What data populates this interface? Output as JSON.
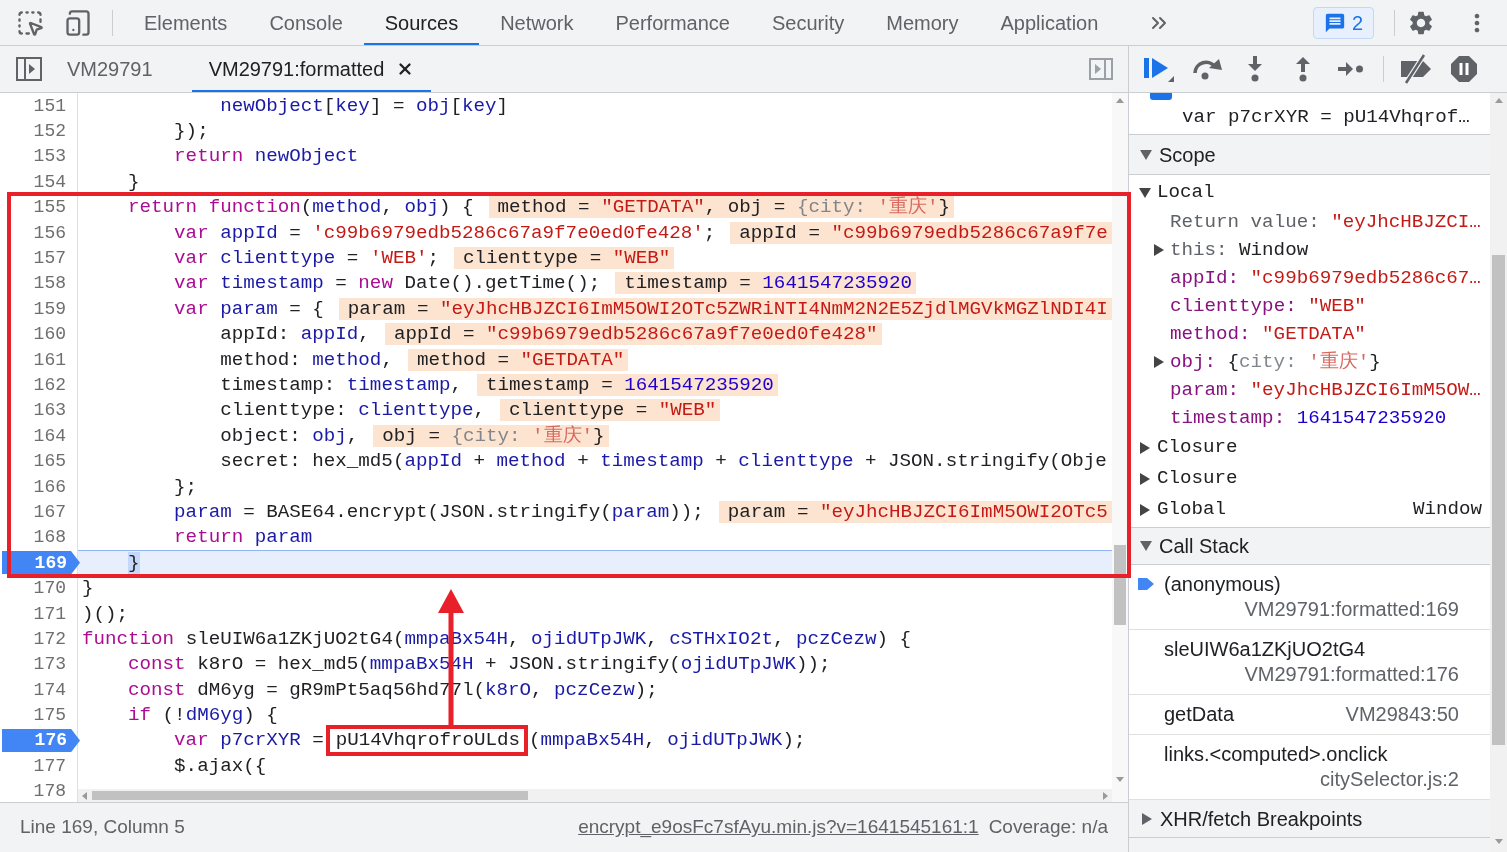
{
  "toolbar": {
    "tabs": [
      {
        "label": "Elements",
        "selected": false
      },
      {
        "label": "Console",
        "selected": false
      },
      {
        "label": "Sources",
        "selected": true
      },
      {
        "label": "Network",
        "selected": false
      },
      {
        "label": "Performance",
        "selected": false
      },
      {
        "label": "Security",
        "selected": false
      },
      {
        "label": "Memory",
        "selected": false
      },
      {
        "label": "Application",
        "selected": false
      }
    ],
    "issues": {
      "count": "2"
    }
  },
  "file_tabs": [
    {
      "label": "VM29791",
      "selected": false,
      "closable": false
    },
    {
      "label": "VM29791:formatted",
      "selected": true,
      "closable": true
    }
  ],
  "editor": {
    "lines": [
      {
        "number": "151",
        "tokens": [
          {
            "text": "            newObject",
            "kind": "variable"
          },
          {
            "text": "[",
            "kind": "plain"
          },
          {
            "text": "key",
            "kind": "variable"
          },
          {
            "text": "] = ",
            "kind": "plain"
          },
          {
            "text": "obj",
            "kind": "variable"
          },
          {
            "text": "[",
            "kind": "plain"
          },
          {
            "text": "key",
            "kind": "variable"
          },
          {
            "text": "]",
            "kind": "plain"
          }
        ],
        "breakpoint": false,
        "current": false
      },
      {
        "number": "152",
        "tokens": [
          {
            "text": "        });",
            "kind": "plain"
          }
        ],
        "breakpoint": false,
        "current": false
      },
      {
        "number": "153",
        "tokens": [
          {
            "text": "        return ",
            "kind": "keyword"
          },
          {
            "text": "newObject",
            "kind": "variable"
          }
        ],
        "breakpoint": false,
        "current": false
      },
      {
        "number": "154",
        "tokens": [
          {
            "text": "    }",
            "kind": "plain"
          }
        ],
        "breakpoint": false,
        "current": false
      },
      {
        "number": "155",
        "tokens": [
          {
            "text": "    return function",
            "kind": "keyword"
          },
          {
            "text": "(",
            "kind": "plain"
          },
          {
            "text": "method",
            "kind": "variable"
          },
          {
            "text": ", ",
            "kind": "plain"
          },
          {
            "text": "obj",
            "kind": "variable"
          },
          {
            "text": ") {",
            "kind": "plain"
          }
        ],
        "inline": [
          {
            "text": "method = ",
            "kind": "plain"
          },
          {
            "text": "\"GETDATA\"",
            "kind": "string"
          },
          {
            "text": ", obj = ",
            "kind": "plain"
          },
          {
            "text": "{city: ",
            "kind": "dim"
          },
          {
            "text": "'重庆'",
            "kind": "cjk"
          },
          {
            "text": "}",
            "kind": "plain"
          }
        ],
        "breakpoint": false,
        "current": false
      },
      {
        "number": "156",
        "tokens": [
          {
            "text": "        var ",
            "kind": "keyword"
          },
          {
            "text": "appId",
            "kind": "variable"
          },
          {
            "text": " = ",
            "kind": "plain"
          },
          {
            "text": "'c99b6979edb5286c67a9f7e0ed0fe428'",
            "kind": "string"
          },
          {
            "text": ";",
            "kind": "plain"
          }
        ],
        "inline": [
          {
            "text": "appId = ",
            "kind": "plain"
          },
          {
            "text": "\"c99b6979edb5286c67a9f7e",
            "kind": "string"
          }
        ],
        "breakpoint": false,
        "current": false
      },
      {
        "number": "157",
        "tokens": [
          {
            "text": "        var ",
            "kind": "keyword"
          },
          {
            "text": "clienttype",
            "kind": "variable"
          },
          {
            "text": " = ",
            "kind": "plain"
          },
          {
            "text": "'WEB'",
            "kind": "string"
          },
          {
            "text": ";",
            "kind": "plain"
          }
        ],
        "inline": [
          {
            "text": "clienttype = ",
            "kind": "plain"
          },
          {
            "text": "\"WEB\"",
            "kind": "string"
          }
        ],
        "breakpoint": false,
        "current": false
      },
      {
        "number": "158",
        "tokens": [
          {
            "text": "        var ",
            "kind": "keyword"
          },
          {
            "text": "timestamp",
            "kind": "variable"
          },
          {
            "text": " = ",
            "kind": "plain"
          },
          {
            "text": "new",
            "kind": "keyword"
          },
          {
            "text": " Date().getTime();",
            "kind": "plain"
          }
        ],
        "inline": [
          {
            "text": "timestamp = ",
            "kind": "plain"
          },
          {
            "text": "1641547235920",
            "kind": "number"
          }
        ],
        "breakpoint": false,
        "current": false
      },
      {
        "number": "159",
        "tokens": [
          {
            "text": "        var ",
            "kind": "keyword"
          },
          {
            "text": "param",
            "kind": "variable"
          },
          {
            "text": " = {",
            "kind": "plain"
          }
        ],
        "inline": [
          {
            "text": "param = ",
            "kind": "plain"
          },
          {
            "text": "\"eyJhcHBJZCI6ImM5OWI2OTc5ZWRiNTI4NmM2N2E5ZjdlMGVkMGZlNDI4I",
            "kind": "string"
          }
        ],
        "breakpoint": false,
        "current": false
      },
      {
        "number": "160",
        "tokens": [
          {
            "text": "            appId: ",
            "kind": "plain"
          },
          {
            "text": "appId",
            "kind": "variable"
          },
          {
            "text": ",",
            "kind": "plain"
          }
        ],
        "inline": [
          {
            "text": "appId = ",
            "kind": "plain"
          },
          {
            "text": "\"c99b6979edb5286c67a9f7e0ed0fe428\"",
            "kind": "string"
          }
        ],
        "breakpoint": false,
        "current": false
      },
      {
        "number": "161",
        "tokens": [
          {
            "text": "            method: ",
            "kind": "plain"
          },
          {
            "text": "method",
            "kind": "variable"
          },
          {
            "text": ",",
            "kind": "plain"
          }
        ],
        "inline": [
          {
            "text": "method = ",
            "kind": "plain"
          },
          {
            "text": "\"GETDATA\"",
            "kind": "string"
          }
        ],
        "breakpoint": false,
        "current": false
      },
      {
        "number": "162",
        "tokens": [
          {
            "text": "            timestamp: ",
            "kind": "plain"
          },
          {
            "text": "timestamp",
            "kind": "variable"
          },
          {
            "text": ",",
            "kind": "plain"
          }
        ],
        "inline": [
          {
            "text": "timestamp = ",
            "kind": "plain"
          },
          {
            "text": "1641547235920",
            "kind": "number"
          }
        ],
        "breakpoint": false,
        "current": false
      },
      {
        "number": "163",
        "tokens": [
          {
            "text": "            clienttype: ",
            "kind": "plain"
          },
          {
            "text": "clienttype",
            "kind": "variable"
          },
          {
            "text": ",",
            "kind": "plain"
          }
        ],
        "inline": [
          {
            "text": "clienttype = ",
            "kind": "plain"
          },
          {
            "text": "\"WEB\"",
            "kind": "string"
          }
        ],
        "breakpoint": false,
        "current": false
      },
      {
        "number": "164",
        "tokens": [
          {
            "text": "            object: ",
            "kind": "plain"
          },
          {
            "text": "obj",
            "kind": "variable"
          },
          {
            "text": ",",
            "kind": "plain"
          }
        ],
        "inline": [
          {
            "text": "obj = ",
            "kind": "plain"
          },
          {
            "text": "{city: ",
            "kind": "dim"
          },
          {
            "text": "'重庆'",
            "kind": "cjk"
          },
          {
            "text": "}",
            "kind": "plain"
          }
        ],
        "breakpoint": false,
        "current": false
      },
      {
        "number": "165",
        "tokens": [
          {
            "text": "            secret: hex_md5(",
            "kind": "plain"
          },
          {
            "text": "appId",
            "kind": "variable"
          },
          {
            "text": " + ",
            "kind": "plain"
          },
          {
            "text": "method",
            "kind": "variable"
          },
          {
            "text": " + ",
            "kind": "plain"
          },
          {
            "text": "timestamp",
            "kind": "variable"
          },
          {
            "text": " + ",
            "kind": "plain"
          },
          {
            "text": "clienttype",
            "kind": "variable"
          },
          {
            "text": " + JSON.stringify(Obje",
            "kind": "plain"
          }
        ],
        "breakpoint": false,
        "current": false
      },
      {
        "number": "166",
        "tokens": [
          {
            "text": "        };",
            "kind": "plain"
          }
        ],
        "breakpoint": false,
        "current": false
      },
      {
        "number": "167",
        "tokens": [
          {
            "text": "        param",
            "kind": "variable"
          },
          {
            "text": " = BASE64.encrypt(JSON.stringify(",
            "kind": "plain"
          },
          {
            "text": "param",
            "kind": "variable"
          },
          {
            "text": "));",
            "kind": "plain"
          }
        ],
        "inline": [
          {
            "text": "param = ",
            "kind": "plain"
          },
          {
            "text": "\"eyJhcHBJZCI6ImM5OWI2OTc5",
            "kind": "string"
          }
        ],
        "breakpoint": false,
        "current": false
      },
      {
        "number": "168",
        "tokens": [
          {
            "text": "        return ",
            "kind": "keyword"
          },
          {
            "text": "param",
            "kind": "variable"
          }
        ],
        "breakpoint": false,
        "current": false
      },
      {
        "number": "169",
        "tokens": [
          {
            "text": "    }",
            "kind": "marker"
          }
        ],
        "breakpoint": true,
        "current": true
      },
      {
        "number": "170",
        "tokens": [
          {
            "text": "}",
            "kind": "plain"
          }
        ],
        "breakpoint": false,
        "current": false
      },
      {
        "number": "171",
        "tokens": [
          {
            "text": ")();",
            "kind": "plain"
          }
        ],
        "breakpoint": false,
        "current": false
      },
      {
        "number": "172",
        "tokens": [
          {
            "text": "function",
            "kind": "keyword"
          },
          {
            "text": " sleUIW6a1ZKjUO2tG4(",
            "kind": "plain"
          },
          {
            "text": "mmpaBx54H",
            "kind": "variable"
          },
          {
            "text": ", ",
            "kind": "plain"
          },
          {
            "text": "ojidUTpJWK",
            "kind": "variable"
          },
          {
            "text": ", ",
            "kind": "plain"
          },
          {
            "text": "cSTHxIO2t",
            "kind": "variable"
          },
          {
            "text": ", ",
            "kind": "plain"
          },
          {
            "text": "pczCezw",
            "kind": "variable"
          },
          {
            "text": ") {",
            "kind": "plain"
          }
        ],
        "breakpoint": false,
        "current": false
      },
      {
        "number": "173",
        "tokens": [
          {
            "text": "    const",
            "kind": "keyword"
          },
          {
            "text": " k8rO = hex_md5(",
            "kind": "plain"
          },
          {
            "text": "mmpaBx54H",
            "kind": "variable"
          },
          {
            "text": " + JSON.stringify(",
            "kind": "plain"
          },
          {
            "text": "ojidUTpJWK",
            "kind": "variable"
          },
          {
            "text": "));",
            "kind": "plain"
          }
        ],
        "breakpoint": false,
        "current": false
      },
      {
        "number": "174",
        "tokens": [
          {
            "text": "    const",
            "kind": "keyword"
          },
          {
            "text": " dM6yg = gR9mPt5aq56hd77l(",
            "kind": "plain"
          },
          {
            "text": "k8rO",
            "kind": "variable"
          },
          {
            "text": ", ",
            "kind": "plain"
          },
          {
            "text": "pczCezw",
            "kind": "variable"
          },
          {
            "text": ");",
            "kind": "plain"
          }
        ],
        "breakpoint": false,
        "current": false
      },
      {
        "number": "175",
        "tokens": [
          {
            "text": "    if",
            "kind": "keyword"
          },
          {
            "text": " (!",
            "kind": "plain"
          },
          {
            "text": "dM6yg",
            "kind": "variable"
          },
          {
            "text": ") {",
            "kind": "plain"
          }
        ],
        "breakpoint": false,
        "current": false
      },
      {
        "number": "176",
        "tokens": [
          {
            "text": "        var ",
            "kind": "keyword"
          },
          {
            "text": "p7crXYR",
            "kind": "variable"
          },
          {
            "text": " =",
            "kind": "plain"
          },
          {
            "text": "pU14VhqrofroULds",
            "kind": "annotated"
          },
          {
            "text": "(",
            "kind": "plain"
          },
          {
            "text": "mmpaBx54H",
            "kind": "variable"
          },
          {
            "text": ", ",
            "kind": "plain"
          },
          {
            "text": "ojidUTpJWK",
            "kind": "variable"
          },
          {
            "text": ");",
            "kind": "plain"
          }
        ],
        "breakpoint": true,
        "current": false
      },
      {
        "number": "177",
        "tokens": [
          {
            "text": "        $.ajax({",
            "kind": "plain"
          }
        ],
        "breakpoint": false,
        "current": false
      },
      {
        "number": "178",
        "breakpoint": false,
        "current": false
      }
    ]
  },
  "status_bar": {
    "position": "Line 169, Column 5",
    "source_link": "encrypt_e9osFc7sfAyu.min.js?v=1641545161:1",
    "coverage": "Coverage: n/a"
  },
  "debugger": {
    "breakpoint": {
      "checked": true,
      "code": "var p7crXYR = pU14Vhqrof…"
    },
    "scope": {
      "label": "Scope",
      "expanded": true,
      "scopes": [
        {
          "label": "Local",
          "expanded": true,
          "variables": [
            {
              "name": "Return value:",
              "kind": "special",
              "value": [
                {
                  "text": "\"eyJhcHBJZCI…",
                  "kind": "string"
                }
              ]
            },
            {
              "name": "this:",
              "kind": "special",
              "expanded": false,
              "value": [
                {
                  "text": "Window",
                  "kind": "plain"
                }
              ]
            },
            {
              "name": "appId:",
              "kind": "own",
              "value": [
                {
                  "text": "\"c99b6979edb5286c67…",
                  "kind": "string"
                }
              ]
            },
            {
              "name": "clienttype:",
              "kind": "own",
              "value": [
                {
                  "text": "\"WEB\"",
                  "kind": "string"
                }
              ]
            },
            {
              "name": "method:",
              "kind": "own",
              "value": [
                {
                  "text": "\"GETDATA\"",
                  "kind": "string"
                }
              ]
            },
            {
              "name": "obj:",
              "kind": "own",
              "expanded": false,
              "value": [
                {
                  "text": "{",
                  "kind": "plain"
                },
                {
                  "text": "city: ",
                  "kind": "dim"
                },
                {
                  "text": "'重庆'",
                  "kind": "cjk"
                },
                {
                  "text": "}",
                  "kind": "plain"
                }
              ]
            },
            {
              "name": "param:",
              "kind": "own",
              "value": [
                {
                  "text": "\"eyJhcHBJZCI6ImM5OW…",
                  "kind": "string"
                }
              ]
            },
            {
              "name": "timestamp:",
              "kind": "own",
              "value": [
                {
                  "text": "1641547235920",
                  "kind": "number"
                }
              ]
            }
          ]
        },
        {
          "label": "Closure",
          "expanded": false
        },
        {
          "label": "Closure",
          "expanded": false
        },
        {
          "label": "Global",
          "expanded": false,
          "value": "Window"
        }
      ]
    },
    "call_stack": {
      "label": "Call Stack",
      "expanded": true,
      "frames": [
        {
          "function": "(anonymous)",
          "location": "VM29791:formatted:169",
          "selected": true
        },
        {
          "function": "sleUIW6a1ZKjUO2tG4",
          "location": "VM29791:formatted:176",
          "selected": false
        },
        {
          "function": "getData",
          "location": "VM29843:50",
          "selected": false
        },
        {
          "function": "links.<computed>.onclick",
          "location": "citySelector.js:2",
          "selected": false
        }
      ]
    },
    "sections": [
      {
        "label": "XHR/fetch Breakpoints",
        "expanded": false
      }
    ]
  }
}
